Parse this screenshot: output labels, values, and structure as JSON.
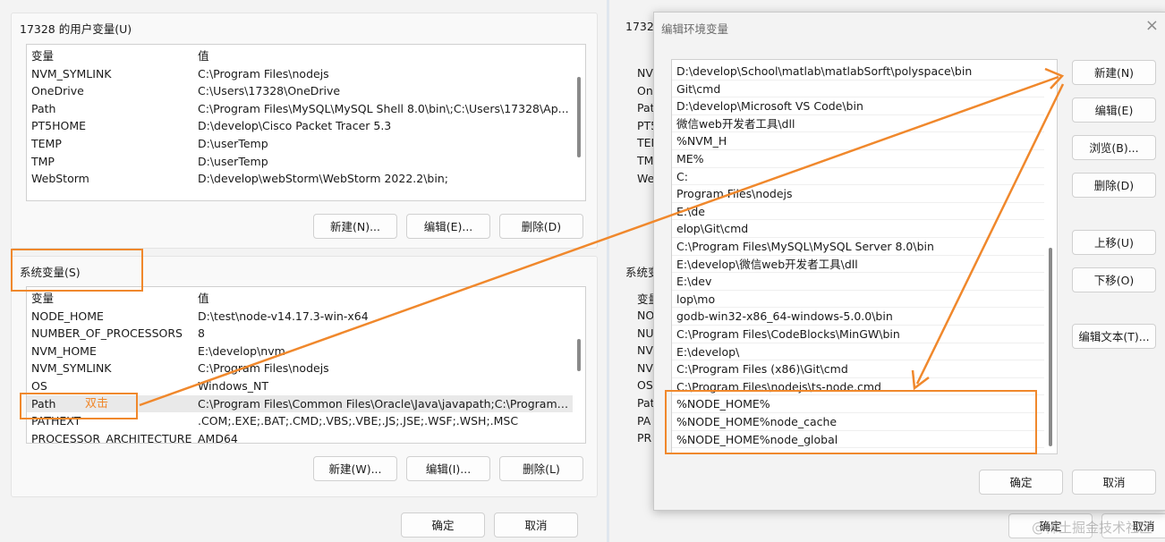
{
  "left_dialog": {
    "user_vars_title": "17328 的用户变量(U)",
    "user_vars_header": {
      "col1": "变量",
      "col2": "值"
    },
    "user_vars": [
      {
        "name": "NVM_SYMLINK",
        "value": "C:\\Program Files\\nodejs"
      },
      {
        "name": "OneDrive",
        "value": "C:\\Users\\17328\\OneDrive"
      },
      {
        "name": "Path",
        "value": "C:\\Program Files\\MySQL\\MySQL Shell 8.0\\bin\\;C:\\Users\\17328\\Ap..."
      },
      {
        "name": "PT5HOME",
        "value": "D:\\develop\\Cisco Packet Tracer 5.3"
      },
      {
        "name": "TEMP",
        "value": "D:\\userTemp"
      },
      {
        "name": "TMP",
        "value": "D:\\userTemp"
      },
      {
        "name": "WebStorm",
        "value": "D:\\develop\\webStorm\\WebStorm 2022.2\\bin;"
      }
    ],
    "user_buttons": {
      "new": "新建(N)...",
      "edit": "编辑(E)...",
      "delete": "删除(D)"
    },
    "sys_vars_title": "系统变量(S)",
    "sys_vars_header": {
      "col1": "变量",
      "col2": "值"
    },
    "sys_vars": [
      {
        "name": "NODE_HOME",
        "value": "D:\\test\\node-v14.17.3-win-x64"
      },
      {
        "name": "NUMBER_OF_PROCESSORS",
        "value": "8"
      },
      {
        "name": "NVM_HOME",
        "value": "E:\\develop\\nvm"
      },
      {
        "name": "NVM_SYMLINK",
        "value": "C:\\Program Files\\nodejs"
      },
      {
        "name": "OS",
        "value": "Windows_NT"
      },
      {
        "name": "Path",
        "value": "C:\\Program Files\\Common Files\\Oracle\\Java\\javapath;C:\\Program ..."
      },
      {
        "name": "PATHEXT",
        "value": ".COM;.EXE;.BAT;.CMD;.VBS;.VBE;.JS;.JSE;.WSF;.WSH;.MSC"
      },
      {
        "name": "PROCESSOR_ARCHITECTURE",
        "value": "AMD64"
      }
    ],
    "sys_buttons": {
      "new": "新建(W)...",
      "edit": "编辑(I)...",
      "delete": "删除(L)"
    },
    "ok": "确定",
    "cancel": "取消",
    "annotation": "双击"
  },
  "background_dialog": {
    "title_fragment": "1732",
    "sys_fragment": "系统变",
    "labels": [
      "NV",
      "On",
      "Pat",
      "PT5",
      "TEN",
      "TM",
      "We"
    ],
    "sys_labels": [
      "变量",
      "NO",
      "NU",
      "NV",
      "NV",
      "OS",
      "Pat",
      "PA",
      "PR"
    ],
    "ok": "确定",
    "cancel": "取消"
  },
  "edit_dialog": {
    "title": "编辑环境变量",
    "close_icon": "×",
    "paths": [
      "D:\\develop\\School\\matlab\\matlabSorft\\polyspace\\bin",
      "Git\\cmd",
      "D:\\develop\\Microsoft VS Code\\bin",
      "微信web开发者工具\\dll",
      "%NVM_H",
      "ME%",
      "C:",
      "Program Files\\nodejs",
      "E:\\de",
      "elop\\Git\\cmd",
      "C:\\Program Files\\MySQL\\MySQL Server 8.0\\bin",
      "E:\\develop\\微信web开发者工具\\dll",
      "E:\\dev",
      "lop\\mo",
      "godb-win32-x86_64-windows-5.0.0\\bin",
      "C:\\Program Files\\CodeBlocks\\MinGW\\bin",
      "E:\\develop\\",
      "C:\\Program Files (x86)\\Git\\cmd",
      "C:\\Program Files\\nodejs\\ts-node.cmd",
      "%NODE_HOME%",
      "%NODE_HOME%node_cache",
      "%NODE_HOME%node_global"
    ],
    "buttons": {
      "new": "新建(N)",
      "edit": "编辑(E)",
      "browse": "浏览(B)...",
      "delete": "删除(D)",
      "move_up": "上移(U)",
      "move_down": "下移(O)",
      "edit_text": "编辑文本(T)..."
    },
    "ok": "确定",
    "cancel": "取消"
  },
  "watermark": "@稀土掘金技术社区",
  "colors": {
    "annotation": "#f0882c",
    "window_bg": "#f3f3f3"
  }
}
